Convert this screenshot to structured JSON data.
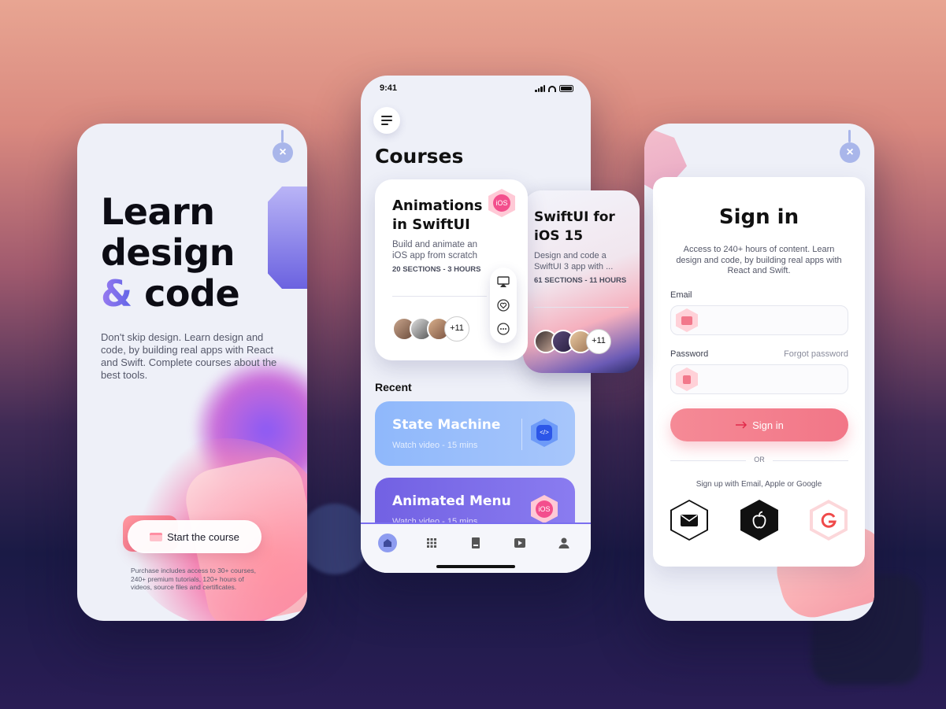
{
  "phone_left": {
    "title_line1": "Learn",
    "title_line2": "design",
    "title_amp": "&",
    "title_line3": "code",
    "description": "Don't skip design. Learn design and code, by building real apps with React and Swift. Complete courses about the best tools.",
    "start_button": "Start the course",
    "fine_print": "Purchase includes access to 30+ courses, 240+ premium tutorials, 120+ hours of videos, source files and certificates.",
    "close_icon": "×"
  },
  "phone_middle": {
    "status_time": "9:41",
    "courses_title": "Courses",
    "courses": [
      {
        "title": "Animations in SwiftUI",
        "description": "Build and animate an iOS app from scratch",
        "meta": "20 SECTIONS - 3 HOURS",
        "badge": "iOS",
        "more_count": "+11"
      },
      {
        "title": "SwiftUI for iOS 15",
        "description": "Design and code a SwiftUI 3 app with ...",
        "meta": "61 SECTIONS - 11 HOURS",
        "more_count": "+11"
      }
    ],
    "recent_title": "Recent",
    "recent": [
      {
        "title": "State Machine",
        "subtitle": "Watch video - 15 mins",
        "badge": "</>"
      },
      {
        "title": "Animated Menu",
        "subtitle": "Watch video - 15 mins",
        "badge": "iOS"
      }
    ],
    "tabs": [
      "home-icon",
      "grid-icon",
      "book-icon",
      "play-icon",
      "user-icon"
    ],
    "colors": {
      "recent1": "#8fb8fb",
      "recent2": "#7261e3",
      "accent": "#7b6ff0"
    }
  },
  "phone_right": {
    "title": "Sign in",
    "description": "Access to 240+ hours of content. Learn design and code, by building real apps with React and Swift.",
    "email_label": "Email",
    "password_label": "Password",
    "forgot_password": "Forgot password",
    "sign_in_button": "Sign in",
    "or_text": "OR",
    "alt_text": "Sign up with Email, Apple or Google",
    "close_icon": "×",
    "colors": {
      "primary": "#f27687"
    }
  }
}
